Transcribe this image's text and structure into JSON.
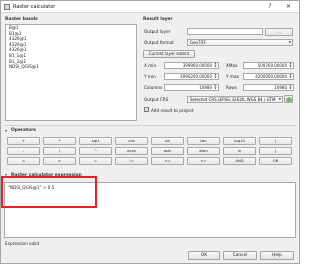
{
  "window": {
    "title": "Raster calculator",
    "help": "?",
    "close": "✕"
  },
  "raster_bands": {
    "title": "Raster bands",
    "items": [
      "B@1",
      "B1@1",
      "4326@1",
      "4326@1",
      "4326@1",
      "B1_1@1",
      "B1_2@1",
      "NDSI_QGIS@1"
    ]
  },
  "result_layer": {
    "title": "Result layer",
    "output_layer_label": "Output layer",
    "output_layer_value": "",
    "browse_label": "...",
    "output_format_label": "Output format",
    "output_format_value": "GeoTIFF",
    "current_extent_label": "Current layer extent",
    "xmin_label": "X min",
    "xmin_value": "399960.00000",
    "xmax_label": "XMax",
    "xmax_value": "509760.00000",
    "ymin_label": "Y min",
    "ymin_value": "4090200.00000",
    "ymax_label": "Y max",
    "ymax_value": "4200000.00000",
    "columns_label": "Columns",
    "columns_value": "10980",
    "rows_label": "Rows",
    "rows_value": "10980",
    "crs_label": "Output CRS",
    "crs_value": "Selected CRS (EPSG:32630, WGS 84 / UTM",
    "add_result_label": "Add result to project",
    "add_result_checked": "✓"
  },
  "operators": {
    "title": "Operators",
    "rows": [
      [
        "+",
        "*",
        "sqrt",
        "cos",
        "sin",
        "tan",
        "log10",
        "("
      ],
      [
        "-",
        "/",
        "^",
        "acos",
        "asin",
        "atan",
        "ln",
        ")"
      ],
      [
        "<",
        ">",
        "=",
        "!=",
        "<=",
        ">=",
        "AND",
        "OR"
      ]
    ]
  },
  "expression": {
    "title": "Raster calculator expression",
    "value": "\"NDSI_QGIS@1\" > 0.5",
    "status": "Expression valid"
  },
  "buttons": {
    "ok": "OK",
    "cancel": "Cancel",
    "help": "Help"
  },
  "colors": {
    "highlight": "#e8202a"
  },
  "icons": {
    "chevron": "chevron-down-icon",
    "crs": "globe-icon"
  }
}
